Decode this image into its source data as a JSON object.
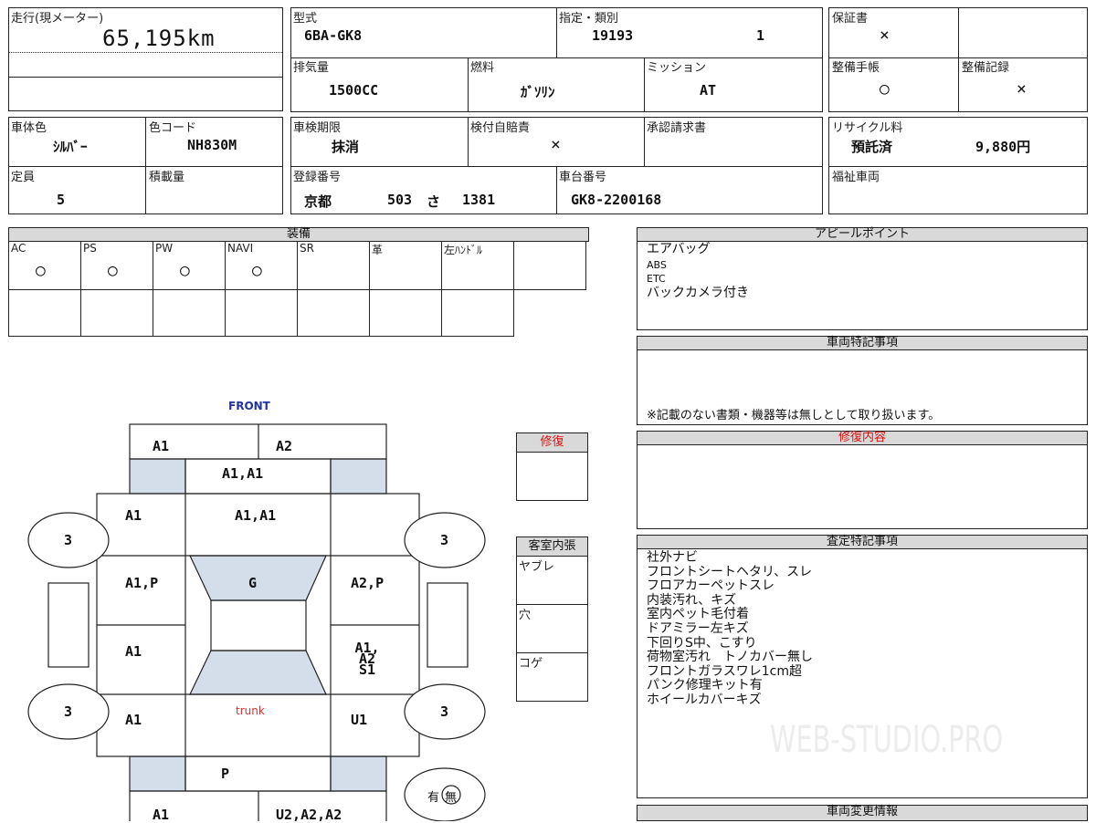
{
  "top": {
    "mileage_label": "走行(現メーター)",
    "mileage_value": "65,195km",
    "model_label": "型式",
    "model_value": "6BA-GK8",
    "designation_label": "指定・類別",
    "designation_value": "19193",
    "class_value": "1",
    "warranty_label": "保証書",
    "warranty_value": "×",
    "displacement_label": "排気量",
    "displacement_value": "1500CC",
    "fuel_label": "燃料",
    "fuel_value": "ｶﾞｿﾘﾝ",
    "mission_label": "ミッション",
    "mission_value": "AT",
    "maint_book_label": "整備手帳",
    "maint_book_value": "○",
    "maint_record_label": "整備記録",
    "maint_record_value": "×",
    "body_color_label": "車体色",
    "body_color_value": "ｼﾙﾊﾞｰ",
    "color_code_label": "色コード",
    "color_code_value": "NH830M",
    "inspection_label": "車検期限",
    "inspection_value": "抹消",
    "insurance_label": "検付自賠責",
    "insurance_value": "×",
    "approval_label": "承認請求書",
    "recycle_label": "リサイクル料",
    "recycle_status": "預託済",
    "recycle_amount": "9,880円",
    "capacity_label": "定員",
    "capacity_value": "5",
    "load_label": "積載量",
    "reg_label": "登録番号",
    "reg_area": "京都",
    "reg_class": "503",
    "reg_kana": "さ",
    "reg_number": "1381",
    "chassis_label": "車台番号",
    "chassis_value": "GK8-2200168",
    "welfare_label": "福祉車両"
  },
  "equipment": {
    "title": "装備",
    "items": [
      {
        "label": "AC",
        "value": "○"
      },
      {
        "label": "PS",
        "value": "○"
      },
      {
        "label": "PW",
        "value": "○"
      },
      {
        "label": "NAVI",
        "value": "○"
      },
      {
        "label": "SR",
        "value": ""
      },
      {
        "label": "革",
        "value": ""
      },
      {
        "label": "左ﾊﾝﾄﾞﾙ",
        "value": ""
      }
    ]
  },
  "appeal": {
    "title": "アピールポイント",
    "lines": [
      "エアバッグ",
      "ABS",
      "ETC",
      "バックカメラ付き"
    ]
  },
  "special": {
    "title": "車両特記事項",
    "note": "※記載のない書類・機器等は無しとして取り扱います。"
  },
  "repair_content": {
    "title": "修復内容"
  },
  "assessment": {
    "title": "査定特記事項",
    "lines": [
      "社外ナビ",
      "フロントシートヘタリ、スレ",
      "フロアカーペットスレ",
      "内装汚れ、キズ",
      "室内ペット毛付着",
      "ドアミラー左キズ",
      "下回りS中、こすり",
      "荷物室汚れ　トノカバー無し",
      "フロントガラスワレ1cm超",
      "パンク修理キット有",
      "ホイールカバーキズ"
    ]
  },
  "change_info": {
    "title": "車両変更情報"
  },
  "repair_box": {
    "title": "修復"
  },
  "interior": {
    "title": "客室内張",
    "rows": [
      "ヤブレ",
      "穴",
      "コゲ"
    ]
  },
  "diagram": {
    "front_label": "FRONT",
    "trunk_label": "trunk",
    "a_top_left": "A1",
    "a_top_right": "A2",
    "hood_top": "A1,A1",
    "hood": "A1,A1",
    "left_fender": "A1",
    "left_front_door": "A1,P",
    "roof": "G",
    "right_front_door": "A2,P",
    "left_rear_door": "A1",
    "right_rear_door": "A1,A2 S1",
    "left_quarter": "A1",
    "right_quarter": "U1",
    "rear_panel": "P",
    "rear_bottom_left": "A1",
    "rear_bottom_right": "U2,A2,A2",
    "tire_fl": "3",
    "tire_fr": "3",
    "tire_rl": "3",
    "tire_rr": "3",
    "spare_yes": "有",
    "spare_no": "無"
  },
  "watermark": "WEB-STUDIO.PRO",
  "colors": {
    "repair_red": "#d11",
    "front_blue": "#2233aa",
    "trunk_red": "#c33",
    "glass": "#d3deea",
    "header_gray": "#d9d9d9"
  }
}
